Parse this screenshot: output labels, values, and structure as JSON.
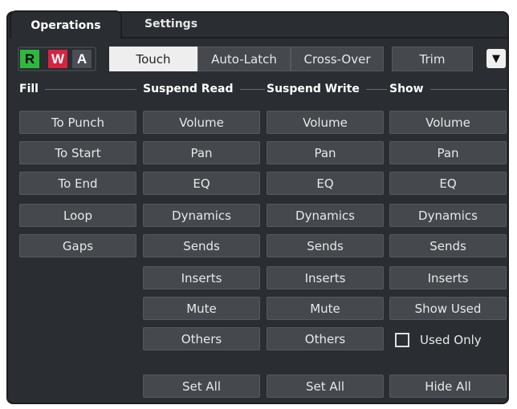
{
  "tabs": [
    "Operations",
    "Settings"
  ],
  "rwa": [
    "R",
    "W",
    "A"
  ],
  "modes": [
    "Touch",
    "Auto-Latch",
    "Cross-Over"
  ],
  "trim_label": "Trim",
  "dropdown_glyph": "▼",
  "sections": [
    "Fill",
    "Suspend Read",
    "Suspend Write",
    "Show"
  ],
  "fill": [
    "To Punch",
    "To Start",
    "To End",
    "Loop",
    "Gaps"
  ],
  "suspend_read": [
    "Volume",
    "Pan",
    "EQ",
    "Dynamics",
    "Sends",
    "Inserts",
    "Mute",
    "Others"
  ],
  "suspend_write": [
    "Volume",
    "Pan",
    "EQ",
    "Dynamics",
    "Sends",
    "Inserts",
    "Mute",
    "Others"
  ],
  "show": [
    "Volume",
    "Pan",
    "EQ",
    "Dynamics",
    "Sends",
    "Inserts",
    "Show Used"
  ],
  "used_only_label": "Used Only",
  "footer": {
    "set_all_read": "Set All",
    "set_all_write": "Set All",
    "hide_all": "Hide All"
  },
  "colors": {
    "bg": "#2a2d31",
    "button": "#45484d",
    "read": "#2eb840",
    "write": "#d6243f"
  }
}
